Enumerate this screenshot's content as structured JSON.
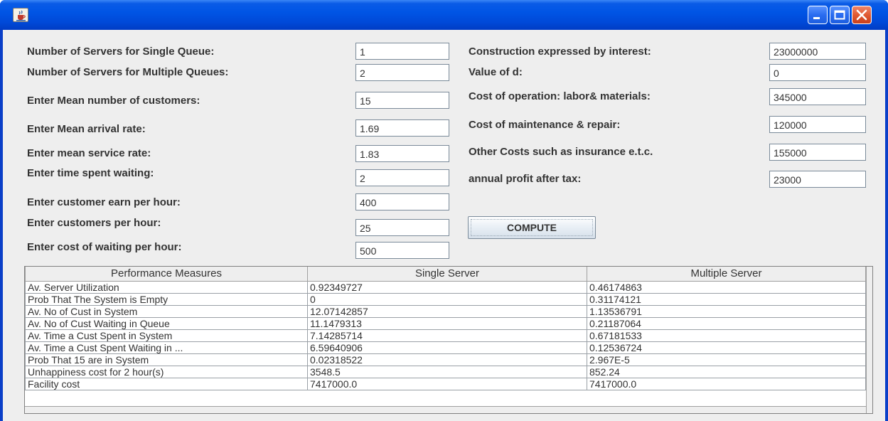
{
  "colors": {
    "titlebar": "#0055e5",
    "close_button": "#e05a33",
    "panel": "#eeeeee"
  },
  "window": {
    "icon": "java-cup-icon",
    "controls": [
      "minimize-icon",
      "maximize-icon",
      "close-icon"
    ]
  },
  "left_form": [
    {
      "label": "Number of Servers for Single Queue:",
      "value": "1"
    },
    {
      "label": "Number of Servers for Multiple Queues:",
      "value": "2"
    },
    {
      "label": "Enter Mean number of customers:",
      "value": "15"
    },
    {
      "label": "Enter Mean arrival rate:",
      "value": "1.69"
    },
    {
      "label": "Enter mean service rate:",
      "value": "1.83"
    },
    {
      "label": "Enter time spent waiting:",
      "value": "2"
    },
    {
      "label": "Enter customer earn per hour:",
      "value": "400"
    },
    {
      "label": "Enter customers per hour:",
      "value": "25"
    },
    {
      "label": "Enter cost of waiting per hour:",
      "value": "500"
    }
  ],
  "right_form": [
    {
      "label": "Construction expressed by interest:",
      "value": "23000000"
    },
    {
      "label": "Value of d:",
      "value": "0"
    },
    {
      "label": "Cost of operation: labor& materials:",
      "value": "345000"
    },
    {
      "label": "Cost of maintenance & repair:",
      "value": "120000"
    },
    {
      "label": "Other Costs such as insurance e.t.c.",
      "value": "155000"
    },
    {
      "label": "annual profit after tax:",
      "value": "23000"
    }
  ],
  "compute_label": "COMPUTE",
  "table": {
    "headers": [
      "Performance Measures",
      "Single Server",
      "Multiple Server"
    ],
    "rows": [
      [
        "Av. Server Utilization",
        "0.92349727",
        "0.46174863"
      ],
      [
        "Prob That The System is Empty",
        "0",
        "0.31174121"
      ],
      [
        "Av. No of Cust in System",
        "12.07142857",
        "1.13536791"
      ],
      [
        "Av. No of Cust Waiting in Queue",
        "11.1479313",
        "0.21187064"
      ],
      [
        "Av. Time a Cust Spent in System",
        "7.14285714",
        "0.67181533"
      ],
      [
        "Av. Time a Cust Spent Waiting in ...",
        "6.59640906",
        "0.12536724"
      ],
      [
        "Prob That 15 are in System",
        "0.02318522",
        "2.967E-5"
      ],
      [
        "Unhappiness cost for 2 hour(s)",
        "3548.5",
        "852.24"
      ],
      [
        "Facility cost",
        "7417000.0",
        "7417000.0"
      ]
    ]
  }
}
